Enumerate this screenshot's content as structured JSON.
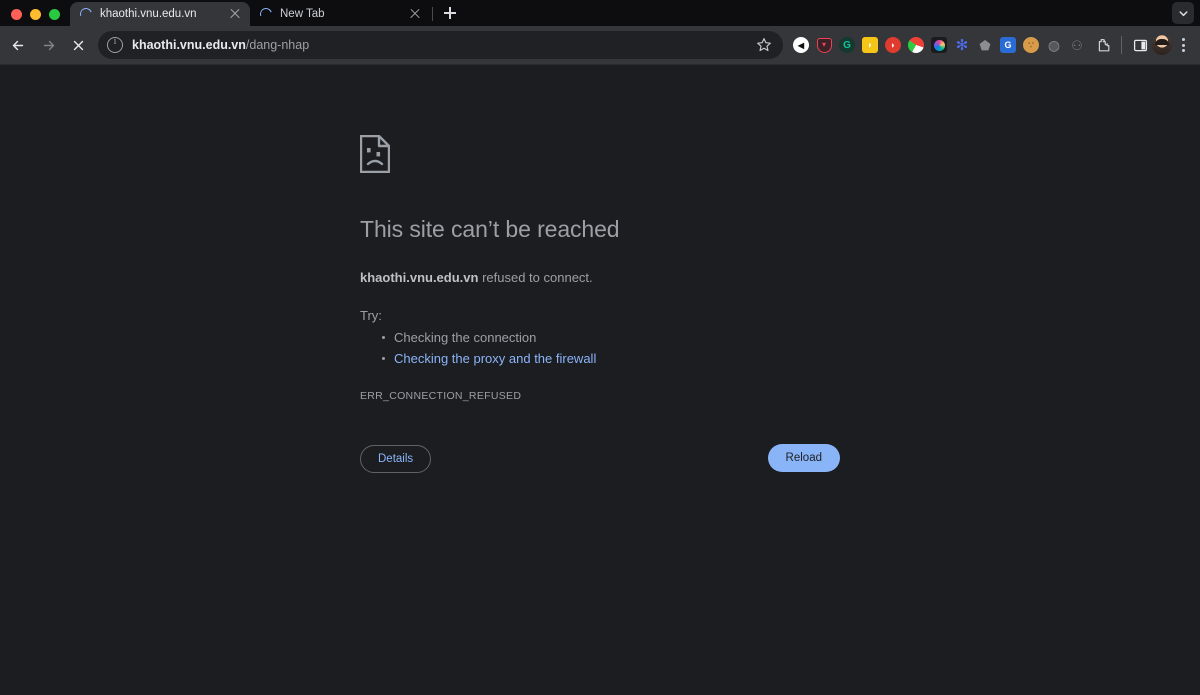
{
  "window": {
    "traffic_lights": [
      {
        "name": "close",
        "color": "#ff5f57"
      },
      {
        "name": "minimize",
        "color": "#febc2e"
      },
      {
        "name": "maximize",
        "color": "#28c840"
      }
    ],
    "tabstrip_bg": "#0d0d0f",
    "toolbar_bg": "#35363a"
  },
  "tabs": [
    {
      "title": "khaothi.vnu.edu.vn",
      "active": true,
      "loading": true
    },
    {
      "title": "New Tab",
      "active": false,
      "loading": true
    }
  ],
  "tabstrip_actions": {
    "new_tab": "+",
    "tab_list_chevron": "chevron-down-icon"
  },
  "toolbar": {
    "back": "back-icon",
    "forward": "forward-icon",
    "stop": "stop-loading-icon",
    "omnibox": {
      "site_info_icon": "info-circle-icon",
      "url_host": "khaothi.vnu.edu.vn",
      "url_path": "/dang-nhap",
      "bookmark_icon": "star-icon"
    },
    "extensions": [
      {
        "name": "back-circle-extension",
        "glyph": "◀",
        "bg": "#ffffff",
        "fg": "#111111",
        "shape": "circle"
      },
      {
        "name": "pocket-extension",
        "glyph": "▽",
        "bg": "#3a2226",
        "fg": "#ef4056",
        "shape": "shield"
      },
      {
        "name": "grammarly-extension",
        "glyph": "G",
        "bg": "#15392f",
        "fg": "#15c39a",
        "shape": "circle"
      },
      {
        "name": "lightbulb-extension",
        "glyph": "●",
        "bg": "#f5c518",
        "fg": "#fff6c0",
        "shape": "square"
      },
      {
        "name": "red-drop-extension",
        "glyph": "•",
        "bg": "#e03b2f",
        "fg": "#ffffff",
        "shape": "circle"
      },
      {
        "name": "colorful-circle-extension",
        "glyph": "",
        "bg": "#ef4136",
        "fg": "#ffffff",
        "shape": "circle"
      },
      {
        "name": "rainbow-ring-extension",
        "glyph": "●",
        "bg": "#1a1a1a",
        "fg": "#b06ab3",
        "shape": "square"
      },
      {
        "name": "asterisk-flower-extension",
        "glyph": "✱",
        "bg": "transparent",
        "fg": "#4f6ef7",
        "shape": "plain"
      },
      {
        "name": "shopify-extension",
        "glyph": "▲",
        "bg": "transparent",
        "fg": "#8a8d91",
        "shape": "plain"
      },
      {
        "name": "google-docs-extension",
        "glyph": "G",
        "bg": "#2b6cd4",
        "fg": "#ffffff",
        "shape": "square"
      },
      {
        "name": "cookie-extension",
        "glyph": "●",
        "bg": "#d79b4a",
        "fg": "#8a5a22",
        "shape": "circle"
      },
      {
        "name": "grey-ring-extension",
        "glyph": "◯",
        "bg": "transparent",
        "fg": "#8a8d91",
        "shape": "plain"
      },
      {
        "name": "robot-extension",
        "glyph": "▣",
        "bg": "transparent",
        "fg": "#77797d",
        "shape": "plain"
      }
    ],
    "puzzle_icon": "extensions-puzzle-icon",
    "side_panel_icon": "side-panel-icon",
    "profile_avatar": "avatar",
    "menu_icon": "three-dot-menu-icon"
  },
  "error_page": {
    "icon": "sad-document-icon",
    "heading": "This site can’t be reached",
    "lede_host": "khaothi.vnu.edu.vn",
    "lede_rest": " refused to connect.",
    "try_label": "Try:",
    "suggestions": [
      {
        "text": "Checking the connection",
        "link": false
      },
      {
        "text": "Checking the proxy and the firewall",
        "link": true
      }
    ],
    "error_code": "ERR_CONNECTION_REFUSED",
    "details_button": "Details",
    "reload_button": "Reload",
    "accent_link_color": "#8ab4f8",
    "text_color": "#9aa0a6",
    "background": "#1c1d21"
  }
}
